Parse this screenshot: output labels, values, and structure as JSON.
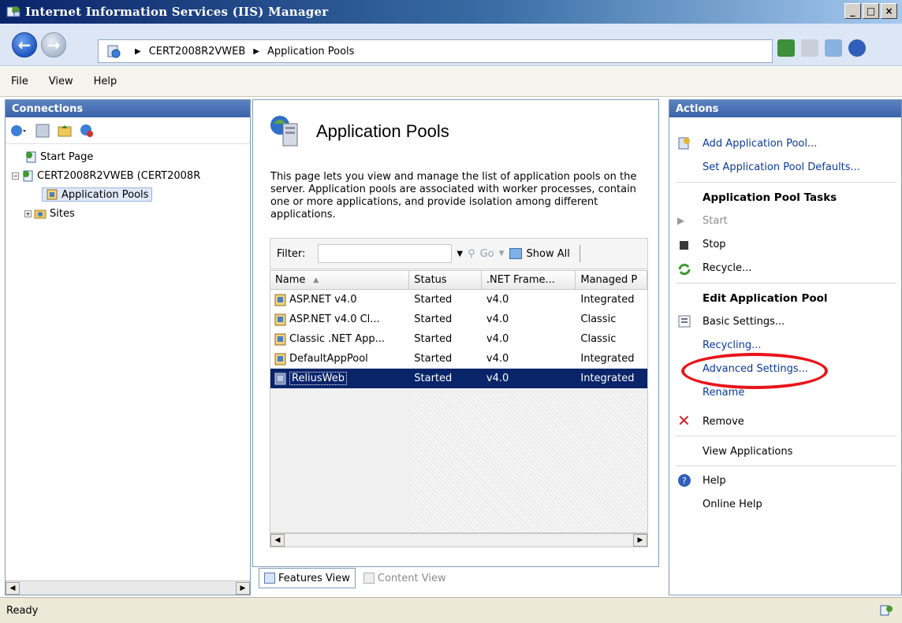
{
  "window": {
    "title": "Internet Information Services (IIS) Manager",
    "controls": [
      "_",
      "□",
      "×"
    ]
  },
  "address": {
    "crumbs": [
      "CERT2008R2VWEB",
      "Application Pools"
    ]
  },
  "menu": {
    "items": [
      "File",
      "View",
      "Help"
    ]
  },
  "connections": {
    "header": "Connections",
    "tree": {
      "start_page": "Start Page",
      "server": "CERT2008R2VWEB (CERT2008R",
      "app_pools": "Application Pools",
      "sites": "Sites"
    }
  },
  "center": {
    "title": "Application Pools",
    "description": "This page lets you view and manage the list of application pools on the server. Application pools are associated with worker processes, contain one or more applications, and provide isolation among different applications.",
    "filter_label": "Filter:",
    "go_label": "Go",
    "show_all_label": "Show All",
    "columns": [
      "Name",
      "Status",
      ".NET Frame...",
      "Managed P"
    ],
    "rows": [
      {
        "name": "ASP.NET v4.0",
        "status": "Started",
        "net": "v4.0",
        "managed": "Integrated"
      },
      {
        "name": "ASP.NET v4.0 Cl...",
        "status": "Started",
        "net": "v4.0",
        "managed": "Classic"
      },
      {
        "name": "Classic .NET App...",
        "status": "Started",
        "net": "v4.0",
        "managed": "Classic"
      },
      {
        "name": "DefaultAppPool",
        "status": "Started",
        "net": "v4.0",
        "managed": "Integrated"
      },
      {
        "name": "ReliusWeb",
        "status": "Started",
        "net": "v4.0",
        "managed": "Integrated"
      }
    ],
    "selected_row": "ReliusWeb",
    "view_tabs": {
      "features": "Features View",
      "content": "Content View"
    }
  },
  "actions": {
    "header": "Actions",
    "add_pool": "Add Application Pool...",
    "set_defaults": "Set Application Pool Defaults...",
    "tasks_heading": "Application Pool Tasks",
    "start": "Start",
    "stop": "Stop",
    "recycle": "Recycle...",
    "edit_heading": "Edit Application Pool",
    "basic_settings": "Basic Settings...",
    "recycling": "Recycling...",
    "advanced_settings": "Advanced Settings...",
    "rename": "Rename",
    "remove": "Remove",
    "view_applications": "View Applications",
    "help": "Help",
    "online_help": "Online Help"
  },
  "status": {
    "text": "Ready"
  },
  "colors": {
    "selection": "#0a246a",
    "link": "#0b3a99",
    "highlight_ring": "#e8141a"
  }
}
